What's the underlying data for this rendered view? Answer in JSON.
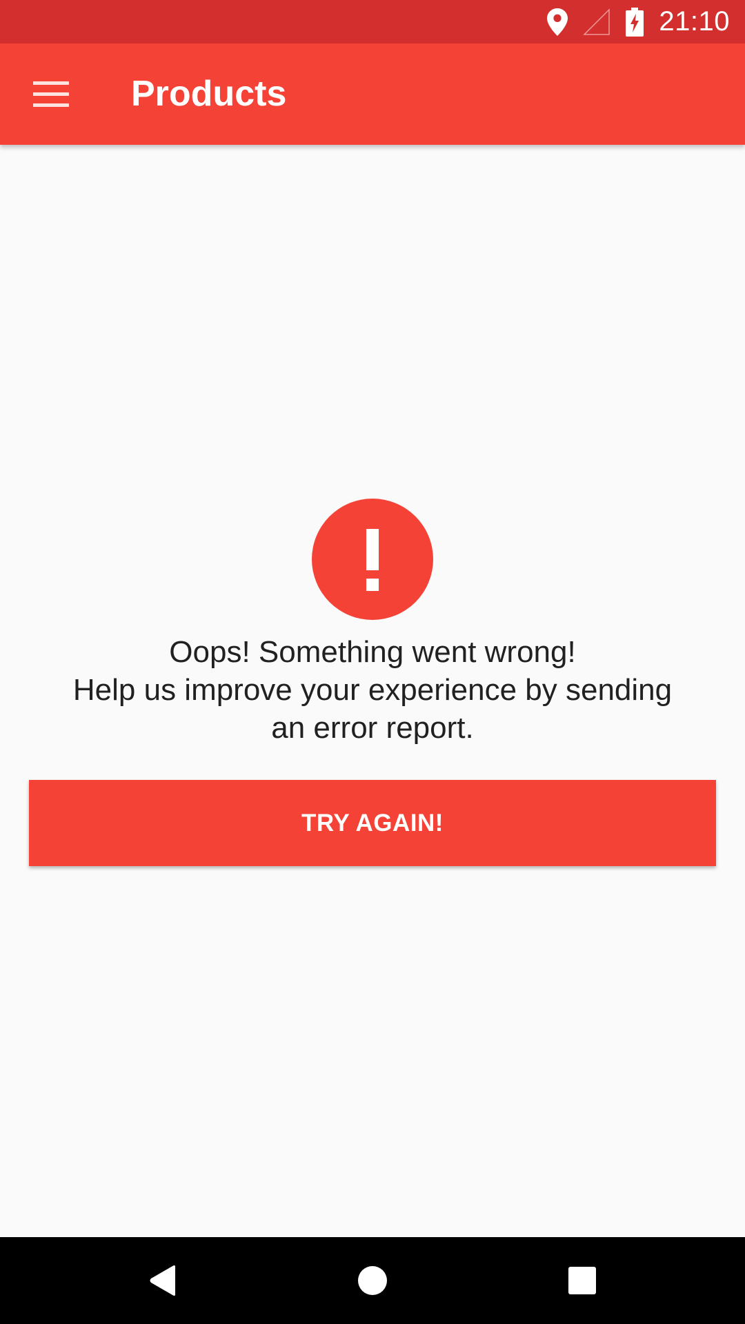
{
  "status_bar": {
    "time": "21:10",
    "icons": [
      "location-icon",
      "signal-icon",
      "battery-charging-icon"
    ],
    "background_color": "#d32f2f"
  },
  "app_bar": {
    "title": "Products",
    "menu_icon": "hamburger-menu-icon",
    "background_color": "#f44336"
  },
  "error": {
    "icon": "error-exclamation-icon",
    "message_lines": [
      "Oops! Something went wrong!",
      "Help us improve your experience by sending",
      "an error report."
    ],
    "button_label": "TRY AGAIN!",
    "accent_color": "#f44336"
  },
  "nav_bar": {
    "buttons": [
      "back-icon",
      "home-icon",
      "recents-icon"
    ]
  }
}
